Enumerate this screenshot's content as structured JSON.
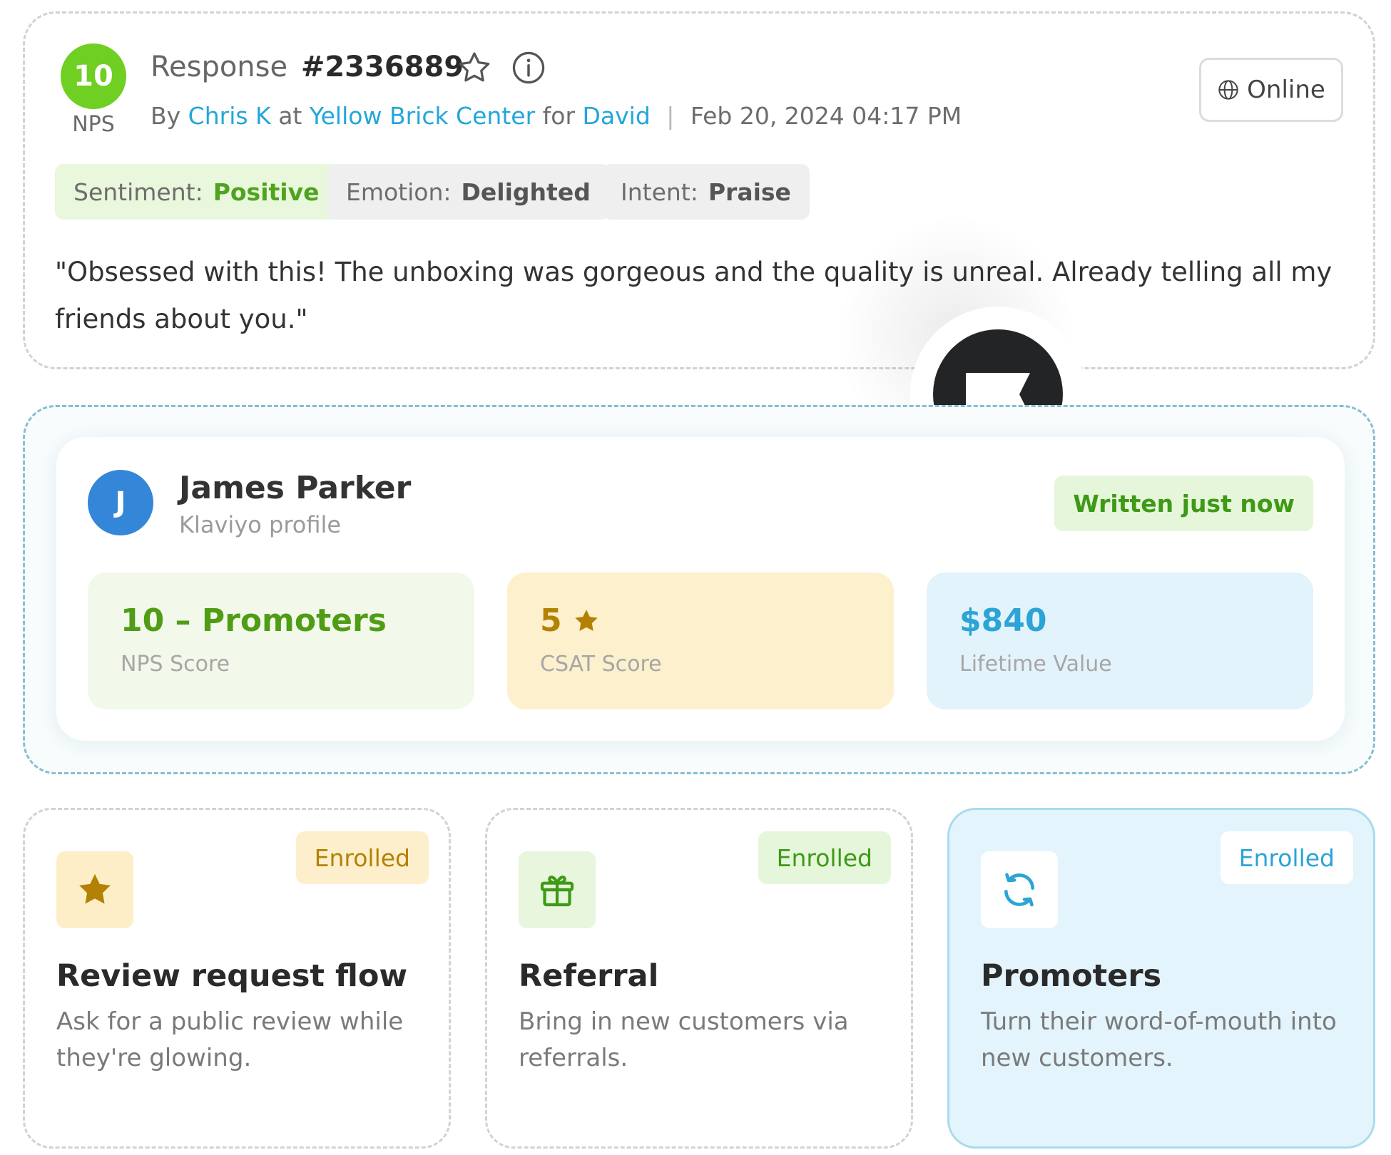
{
  "response": {
    "score": "10",
    "score_type": "NPS",
    "title_prefix": "Response",
    "id": "#2336889",
    "by_prefix": "By",
    "author": "Chris K",
    "at_word": "at",
    "location": "Yellow Brick Center",
    "for_word": "for",
    "recipient": "David",
    "separator": "|",
    "timestamp": "Feb 20, 2024 04:17 PM",
    "channel": "Online",
    "tags": {
      "sentiment": {
        "key": "Sentiment:",
        "value": "Positive"
      },
      "emotion": {
        "key": "Emotion:",
        "value": "Delighted"
      },
      "intent": {
        "key": "Intent:",
        "value": "Praise"
      }
    },
    "quote": "\"Obsessed with this! The unboxing was gorgeous and the quality is unreal. Already telling all my friends about you.\""
  },
  "profile": {
    "initial": "J",
    "name": "James Parker",
    "source": "Klaviyo profile",
    "status": "Written just now",
    "stats": {
      "nps": {
        "value": "10 – Promoters",
        "label": "NPS Score"
      },
      "csat": {
        "value": "5",
        "label": "CSAT Score"
      },
      "ltv": {
        "value": "$840",
        "label": "Lifetime Value"
      }
    }
  },
  "flows": [
    {
      "icon": "star-icon",
      "status": "Enrolled",
      "title": "Review request flow",
      "description": "Ask for a public review while they're glowing."
    },
    {
      "icon": "gift-icon",
      "status": "Enrolled",
      "title": "Referral",
      "description": "Bring in new customers via referrals."
    },
    {
      "icon": "refresh-icon",
      "status": "Enrolled",
      "title": "Promoters",
      "description": "Turn their word-of-mouth into new customers."
    }
  ],
  "colors": {
    "nps_green": "#6fcf22",
    "link_blue": "#22a7d8",
    "avatar_blue": "#3486d8",
    "gold": "#b38205",
    "badge_dark": "#232426"
  }
}
